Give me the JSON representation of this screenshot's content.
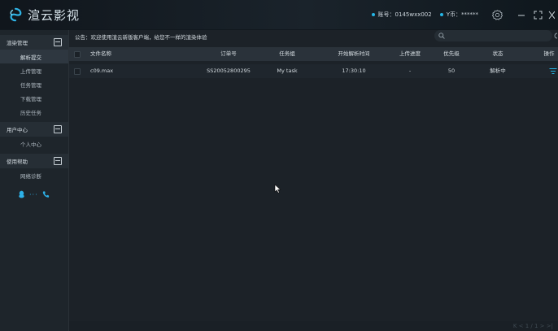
{
  "app": {
    "name": "渲云影视",
    "account_label": "账号：",
    "account_value": "0145wxx002",
    "balance_label": "Y币：",
    "balance_value": "******"
  },
  "colors": {
    "accent": "#25b6e6",
    "background": "#1c2228",
    "sidebar": "#1e252b"
  },
  "sidebar": {
    "sections": [
      {
        "label": "渲染管理",
        "items": [
          "解析提交",
          "上传管理",
          "任务管理",
          "下载管理",
          "历史任务"
        ]
      },
      {
        "label": "用户中心",
        "items": [
          "个人中心"
        ]
      },
      {
        "label": "使用帮助",
        "items": [
          "网络诊断"
        ]
      }
    ],
    "active_item": "解析提交",
    "contacts": [
      "qq-icon",
      "more-dots",
      "phone-icon"
    ],
    "dots": "···"
  },
  "notice": "公告：欢迎使用渲云新版客户端，给您不一样的渲染体验",
  "search": {
    "placeholder": "",
    "value": ""
  },
  "table": {
    "columns": [
      "文件名称",
      "订单号",
      "任务组",
      "开始解析时间",
      "上传进度",
      "优先级",
      "状态",
      "操作"
    ],
    "rows": [
      {
        "file": "c09.max",
        "order": "SS20052800295",
        "group": "My task",
        "start_time": "17:30:10",
        "progress": "-",
        "priority": "50",
        "status": "解析中",
        "action_icon": "filter-icon"
      }
    ]
  },
  "pager": {
    "text": "K < 1 / 1 > >|"
  }
}
